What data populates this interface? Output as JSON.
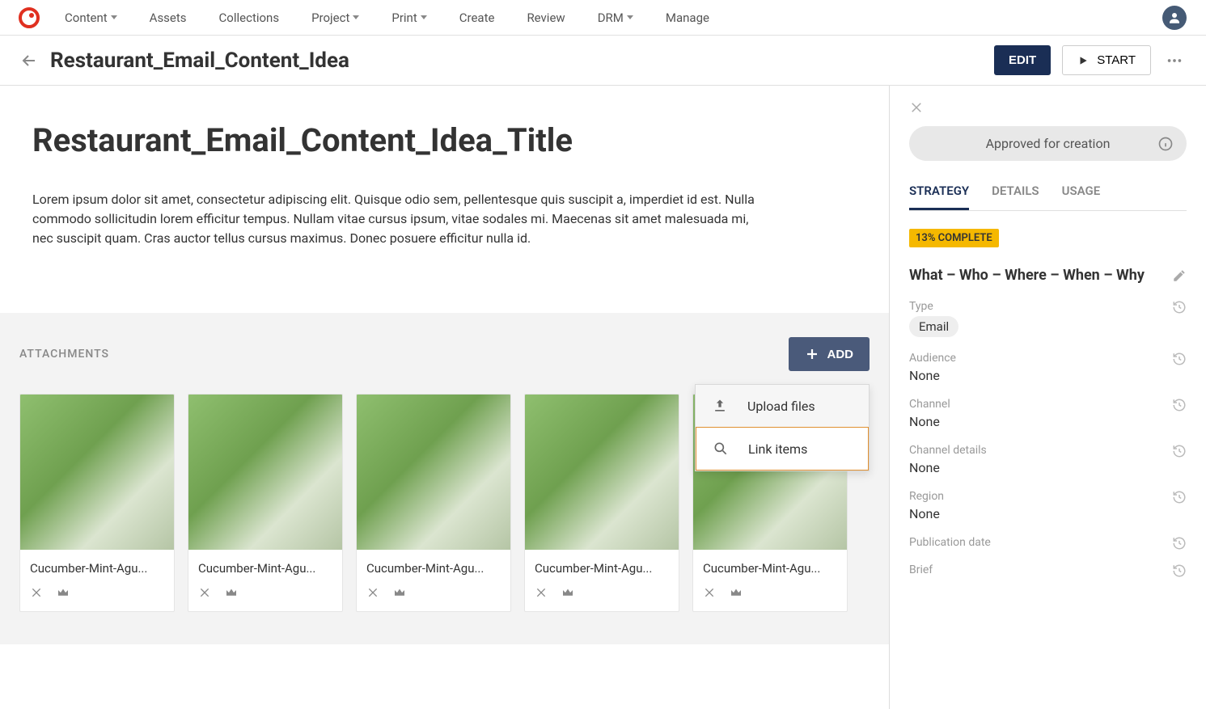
{
  "nav": {
    "items": [
      "Content",
      "Assets",
      "Collections",
      "Project",
      "Print",
      "Create",
      "Review",
      "DRM",
      "Manage"
    ],
    "dropdowns": [
      true,
      false,
      false,
      true,
      true,
      false,
      false,
      true,
      false
    ]
  },
  "titleBar": {
    "title": "Restaurant_Email_Content_Idea",
    "editLabel": "EDIT",
    "startLabel": "START"
  },
  "doc": {
    "heading": "Restaurant_Email_Content_Idea_Title",
    "body": "Lorem ipsum dolor sit amet, consectetur adipiscing elit. Quisque odio sem, pellentesque quis suscipit a, imperdiet id est. Nulla commodo sollicitudin lorem efficitur tempus. Nullam vitae cursus ipsum, vitae sodales mi. Maecenas sit amet malesuada mi, nec suscipit quam. Cras auctor tellus cursus maximus. Donec posuere efficitur nulla id."
  },
  "attachments": {
    "sectionLabel": "ATTACHMENTS",
    "addLabel": "ADD",
    "items": [
      {
        "name": "Cucumber-Mint-Agu..."
      },
      {
        "name": "Cucumber-Mint-Agu..."
      },
      {
        "name": "Cucumber-Mint-Agu..."
      },
      {
        "name": "Cucumber-Mint-Agu..."
      },
      {
        "name": "Cucumber-Mint-Agu..."
      }
    ],
    "dropdown": {
      "uploadLabel": "Upload files",
      "linkLabel": "Link items"
    }
  },
  "side": {
    "status": "Approved for creation",
    "tabs": [
      "STRATEGY",
      "DETAILS",
      "USAGE"
    ],
    "activeTab": 0,
    "complete": "13% COMPLETE",
    "sectionTitle": "What – Who – Where – When – Why",
    "fields": [
      {
        "label": "Type",
        "value": "Email",
        "chip": true,
        "history": true
      },
      {
        "label": "Audience",
        "value": "None",
        "chip": false,
        "history": true
      },
      {
        "label": "Channel",
        "value": "None",
        "chip": false,
        "history": true
      },
      {
        "label": "Channel details",
        "value": "None",
        "chip": false,
        "history": true
      },
      {
        "label": "Region",
        "value": "None",
        "chip": false,
        "history": true
      },
      {
        "label": "Publication date",
        "value": "",
        "chip": false,
        "history": true
      },
      {
        "label": "Brief",
        "value": "",
        "chip": false,
        "history": true
      }
    ]
  }
}
